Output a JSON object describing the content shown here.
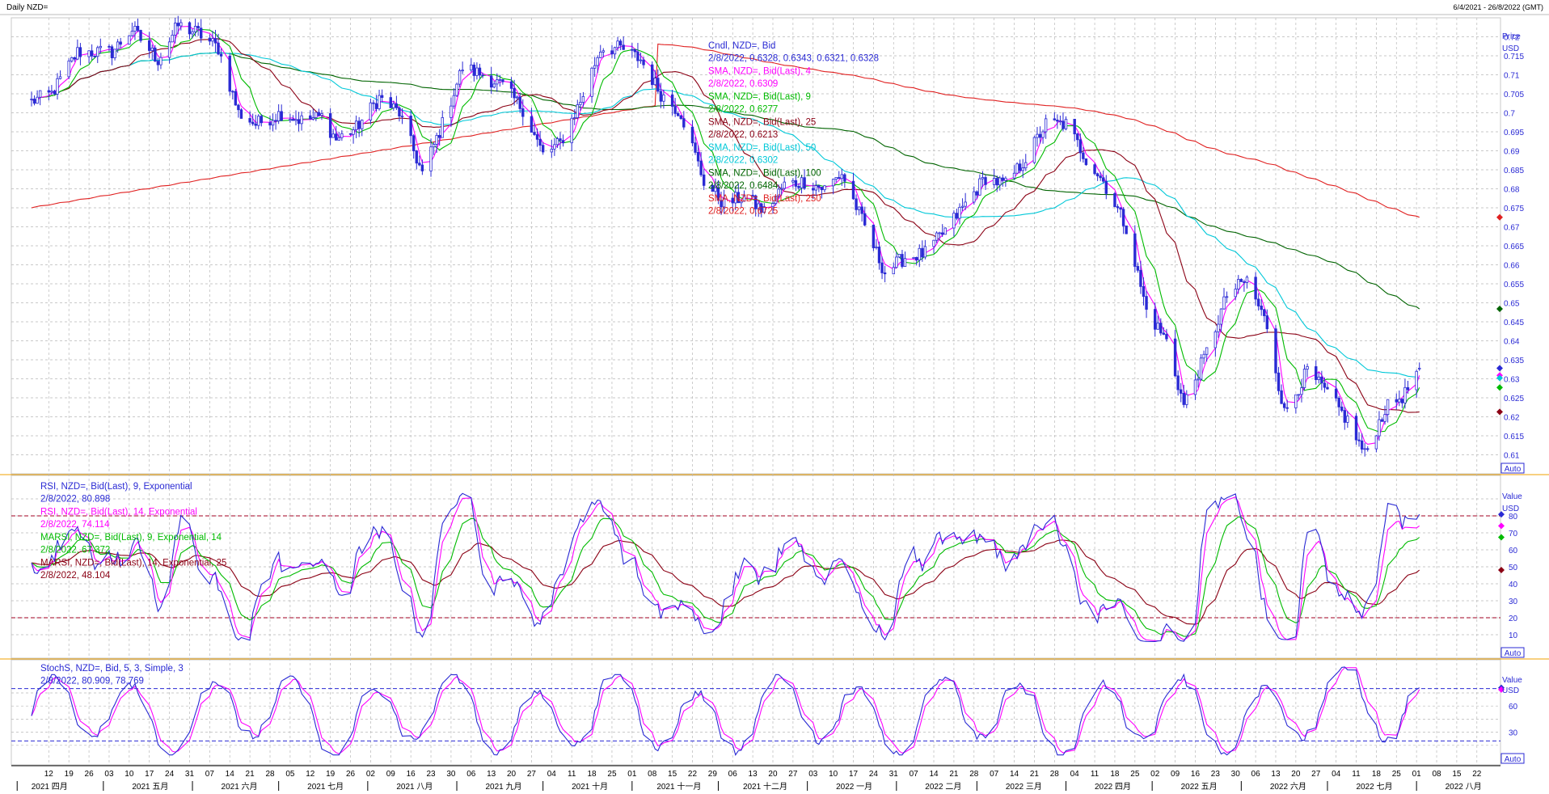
{
  "window": {
    "title": "Daily NZD=",
    "range": "6/4/2021 - 26/8/2022 (GMT)"
  },
  "colors": {
    "candle": "#2a2ad4",
    "sma4": "#ff00ff",
    "sma9": "#00bb00",
    "sma25": "#8b0014",
    "sma50": "#00c8d8",
    "sma100": "#006400",
    "sma250": "#e02020",
    "rsi9": "#2a2ad4",
    "rsi14": "#ff00ff",
    "marsi9": "#00bb00",
    "marsi25": "#8b0014",
    "stoch_k": "#2a2ad4",
    "stoch_d": "#ff00ff",
    "grid": "#b8b8b8",
    "separator": "#f0a000",
    "ref_line_red": "#a00020",
    "ref_line_blue": "#2a2ad4"
  },
  "price_panel": {
    "axis_title": "Price",
    "axis_unit": "USD",
    "auto_label": "Auto",
    "ticks": [
      "0.72",
      "0.715",
      "0.71",
      "0.705",
      "0.7",
      "0.695",
      "0.69",
      "0.685",
      "0.68",
      "0.675",
      "0.67",
      "0.665",
      "0.66",
      "0.655",
      "0.65",
      "0.645",
      "0.64",
      "0.635",
      "0.63",
      "0.625",
      "0.62",
      "0.615",
      "0.61"
    ],
    "legend": [
      {
        "name": "Cndl, NZD=, Bid",
        "value": "2/8/2022, 0.6328, 0.6343, 0.6321, 0.6328",
        "color": "#2a2ad4"
      },
      {
        "name": "SMA, NZD=, Bid(Last), 4",
        "value": "2/8/2022, 0.6309",
        "color": "#ff00ff"
      },
      {
        "name": "SMA, NZD=, Bid(Last), 9",
        "value": "2/8/2022, 0.6277",
        "color": "#00bb00"
      },
      {
        "name": "SMA, NZD=, Bid(Last), 25",
        "value": "2/8/2022, 0.6213",
        "color": "#8b0014"
      },
      {
        "name": "SMA, NZD=, Bid(Last), 50",
        "value": "2/8/2022, 0.6302",
        "color": "#00c8d8"
      },
      {
        "name": "SMA, NZD=, Bid(Last), 100",
        "value": "2/8/2022, 0.6484",
        "color": "#006400"
      },
      {
        "name": "SMA, NZD=, Bid(Last), 250",
        "value": "2/8/2022, 0.6725",
        "color": "#e02020"
      }
    ]
  },
  "rsi_panel": {
    "axis_title": "Value",
    "axis_unit": "USD",
    "auto_label": "Auto",
    "ticks": [
      "80",
      "70",
      "60",
      "50",
      "40",
      "30",
      "20",
      "10"
    ],
    "legend": [
      {
        "name": "RSI, NZD=, Bid(Last), 9, Exponential",
        "value": "2/8/2022, 80.898",
        "color": "#2a2ad4"
      },
      {
        "name": "RSI, NZD=, Bid(Last), 14, Exponential",
        "value": "2/8/2022, 74.114",
        "color": "#ff00ff"
      },
      {
        "name": "MARSI, NZD=, Bid(Last), 9, Exponential, 14",
        "value": "2/8/2022, 67.372",
        "color": "#00bb00"
      },
      {
        "name": "MARSI, NZD=, Bid(Last), 14, Exponential, 25",
        "value": "2/8/2022, 48.104",
        "color": "#8b0014"
      }
    ]
  },
  "stoch_panel": {
    "axis_title": "Value",
    "axis_unit": "USD",
    "auto_label": "Auto",
    "ticks": [
      "60",
      "30"
    ],
    "legend": [
      {
        "name": "StochS, NZD=, Bid, 5, 3, Simple, 3",
        "value": "2/8/2022, 80.909, 78.769",
        "color": "#2a2ad4"
      }
    ]
  },
  "x_axis": {
    "day_labels": [
      "12",
      "19",
      "26",
      "03",
      "10",
      "17",
      "24",
      "31",
      "07",
      "14",
      "21",
      "28",
      "05",
      "12",
      "19",
      "26",
      "02",
      "09",
      "16",
      "23",
      "30",
      "06",
      "13",
      "20",
      "27",
      "04",
      "11",
      "18",
      "25",
      "01",
      "08",
      "15",
      "22",
      "29",
      "06",
      "13",
      "20",
      "27",
      "03",
      "10",
      "17",
      "24",
      "31",
      "07",
      "14",
      "21",
      "28",
      "07",
      "14",
      "21",
      "28",
      "04",
      "11",
      "18",
      "25",
      "02",
      "09",
      "16",
      "23",
      "30",
      "06",
      "13",
      "20",
      "27",
      "04",
      "11",
      "18",
      "25",
      "01",
      "08",
      "15",
      "22"
    ],
    "month_labels": [
      "2021 四月",
      "2021 五月",
      "2021 六月",
      "2021 七月",
      "2021 八月",
      "2021 九月",
      "2021 十月",
      "2021 十一月",
      "2021 十二月",
      "2022 一月",
      "2022 二月",
      "2022 三月",
      "2022 四月",
      "2022 五月",
      "2022 六月",
      "2022 七月",
      "2022 八月"
    ]
  },
  "chart_data": {
    "type": "candlestick",
    "instrument": "NZD=",
    "interval": "Daily",
    "x_start": "2021-04-06",
    "x_end": "2022-08-26",
    "last_bar": {
      "date": "2/8/2022",
      "open": 0.6328,
      "high": 0.6343,
      "low": 0.6321,
      "close": 0.6328
    },
    "price_range": [
      0.605,
      0.725
    ],
    "price_anchors": [
      {
        "date": "2021-04-06",
        "close": 0.703
      },
      {
        "date": "2021-04-13",
        "close": 0.705
      },
      {
        "date": "2021-04-22",
        "close": 0.716
      },
      {
        "date": "2021-05-04",
        "close": 0.716
      },
      {
        "date": "2021-05-11",
        "close": 0.722
      },
      {
        "date": "2021-05-20",
        "close": 0.714
      },
      {
        "date": "2021-05-27",
        "close": 0.723
      },
      {
        "date": "2021-06-03",
        "close": 0.721
      },
      {
        "date": "2021-06-10",
        "close": 0.717
      },
      {
        "date": "2021-06-17",
        "close": 0.7
      },
      {
        "date": "2021-06-23",
        "close": 0.697
      },
      {
        "date": "2021-07-02",
        "close": 0.7
      },
      {
        "date": "2021-07-09",
        "close": 0.698
      },
      {
        "date": "2021-07-16",
        "close": 0.699
      },
      {
        "date": "2021-07-21",
        "close": 0.693
      },
      {
        "date": "2021-07-28",
        "close": 0.696
      },
      {
        "date": "2021-08-05",
        "close": 0.704
      },
      {
        "date": "2021-08-12",
        "close": 0.7
      },
      {
        "date": "2021-08-20",
        "close": 0.684
      },
      {
        "date": "2021-08-27",
        "close": 0.697
      },
      {
        "date": "2021-09-03",
        "close": 0.712
      },
      {
        "date": "2021-09-10",
        "close": 0.71
      },
      {
        "date": "2021-09-17",
        "close": 0.707
      },
      {
        "date": "2021-09-24",
        "close": 0.701
      },
      {
        "date": "2021-10-01",
        "close": 0.689
      },
      {
        "date": "2021-10-07",
        "close": 0.692
      },
      {
        "date": "2021-10-14",
        "close": 0.703
      },
      {
        "date": "2021-10-21",
        "close": 0.717
      },
      {
        "date": "2021-10-28",
        "close": 0.717
      },
      {
        "date": "2021-11-04",
        "close": 0.714
      },
      {
        "date": "2021-11-11",
        "close": 0.705
      },
      {
        "date": "2021-11-18",
        "close": 0.7
      },
      {
        "date": "2021-11-26",
        "close": 0.682
      },
      {
        "date": "2021-12-03",
        "close": 0.676
      },
      {
        "date": "2021-12-10",
        "close": 0.678
      },
      {
        "date": "2021-12-17",
        "close": 0.674
      },
      {
        "date": "2021-12-24",
        "close": 0.681
      },
      {
        "date": "2021-12-31",
        "close": 0.682
      },
      {
        "date": "2022-01-07",
        "close": 0.68
      },
      {
        "date": "2022-01-13",
        "close": 0.684
      },
      {
        "date": "2022-01-21",
        "close": 0.67
      },
      {
        "date": "2022-01-28",
        "close": 0.658
      },
      {
        "date": "2022-02-04",
        "close": 0.662
      },
      {
        "date": "2022-02-11",
        "close": 0.663
      },
      {
        "date": "2022-02-18",
        "close": 0.669
      },
      {
        "date": "2022-02-25",
        "close": 0.676
      },
      {
        "date": "2022-03-04",
        "close": 0.683
      },
      {
        "date": "2022-03-11",
        "close": 0.681
      },
      {
        "date": "2022-03-18",
        "close": 0.688
      },
      {
        "date": "2022-03-25",
        "close": 0.697
      },
      {
        "date": "2022-04-01",
        "close": 0.697
      },
      {
        "date": "2022-04-08",
        "close": 0.688
      },
      {
        "date": "2022-04-14",
        "close": 0.682
      },
      {
        "date": "2022-04-22",
        "close": 0.67
      },
      {
        "date": "2022-04-29",
        "close": 0.648
      },
      {
        "date": "2022-05-06",
        "close": 0.64
      },
      {
        "date": "2022-05-12",
        "close": 0.623
      },
      {
        "date": "2022-05-20",
        "close": 0.637
      },
      {
        "date": "2022-05-27",
        "close": 0.652
      },
      {
        "date": "2022-06-03",
        "close": 0.656
      },
      {
        "date": "2022-06-10",
        "close": 0.644
      },
      {
        "date": "2022-06-16",
        "close": 0.621
      },
      {
        "date": "2022-06-24",
        "close": 0.632
      },
      {
        "date": "2022-07-01",
        "close": 0.626
      },
      {
        "date": "2022-07-08",
        "close": 0.619
      },
      {
        "date": "2022-07-14",
        "close": 0.61
      },
      {
        "date": "2022-07-21",
        "close": 0.622
      },
      {
        "date": "2022-07-28",
        "close": 0.626
      },
      {
        "date": "2022-08-02",
        "close": 0.6328
      }
    ],
    "sma_last_values": {
      "sma4": 0.6309,
      "sma9": 0.6277,
      "sma25": 0.6213,
      "sma50": 0.6302,
      "sma100": 0.6484,
      "sma250": 0.6725
    },
    "rsi": {
      "rsi9_last": 80.898,
      "rsi14_last": 74.114,
      "marsi9_last": 67.372,
      "marsi25_last": 48.104,
      "upper": 80,
      "lower": 20
    },
    "stoch": {
      "k_last": 80.909,
      "d_last": 78.769,
      "upper": 80,
      "lower": 20
    }
  }
}
